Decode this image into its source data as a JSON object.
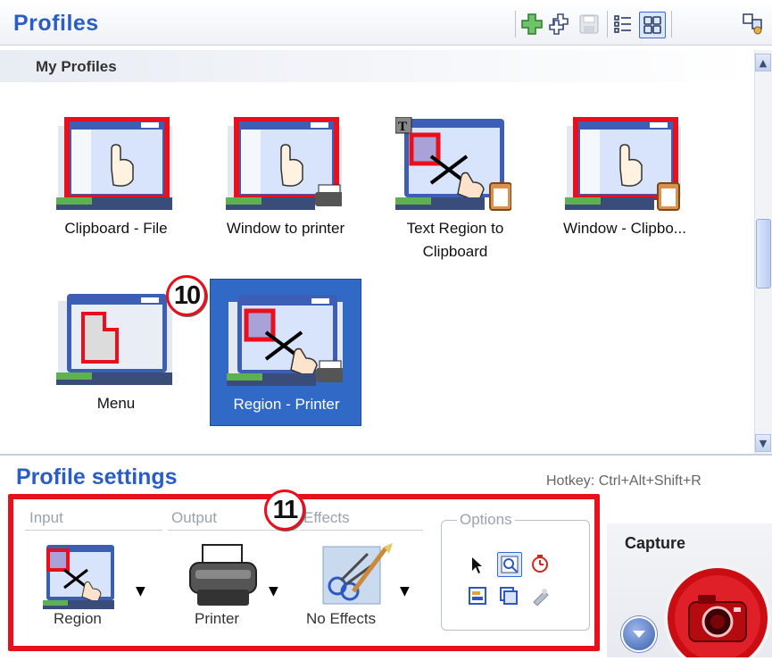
{
  "header": {
    "title": "Profiles"
  },
  "toolbar": {
    "icons": [
      "add-profile-icon",
      "duplicate-profile-icon",
      "save-profile-icon",
      "details-view-icon",
      "large-icons-view-icon",
      "profile-settings-icon"
    ]
  },
  "my_profiles": {
    "label": "My Profiles",
    "tiles": [
      {
        "label": "Clipboard - File"
      },
      {
        "label": "Window to printer"
      },
      {
        "label": "Text Region to Clipboard"
      },
      {
        "label": "Window - Clipbo..."
      },
      {
        "label": "Menu"
      },
      {
        "label": "Region - Printer",
        "selected": true
      }
    ]
  },
  "settings": {
    "title": "Profile settings",
    "hotkey": "Hotkey: Ctrl+Alt+Shift+R",
    "input": {
      "label": "Input",
      "value": "Region"
    },
    "output": {
      "label": "Output",
      "value": "Printer"
    },
    "effects": {
      "label": "Effects",
      "value": "No Effects"
    },
    "options": {
      "label": "Options"
    },
    "capture": {
      "label": "Capture"
    }
  },
  "annotations": {
    "badge_a": "10",
    "badge_b": "11"
  },
  "colors": {
    "accent": "#2a5ec6",
    "selection": "#3169c6",
    "highlight": "#e8101c"
  }
}
